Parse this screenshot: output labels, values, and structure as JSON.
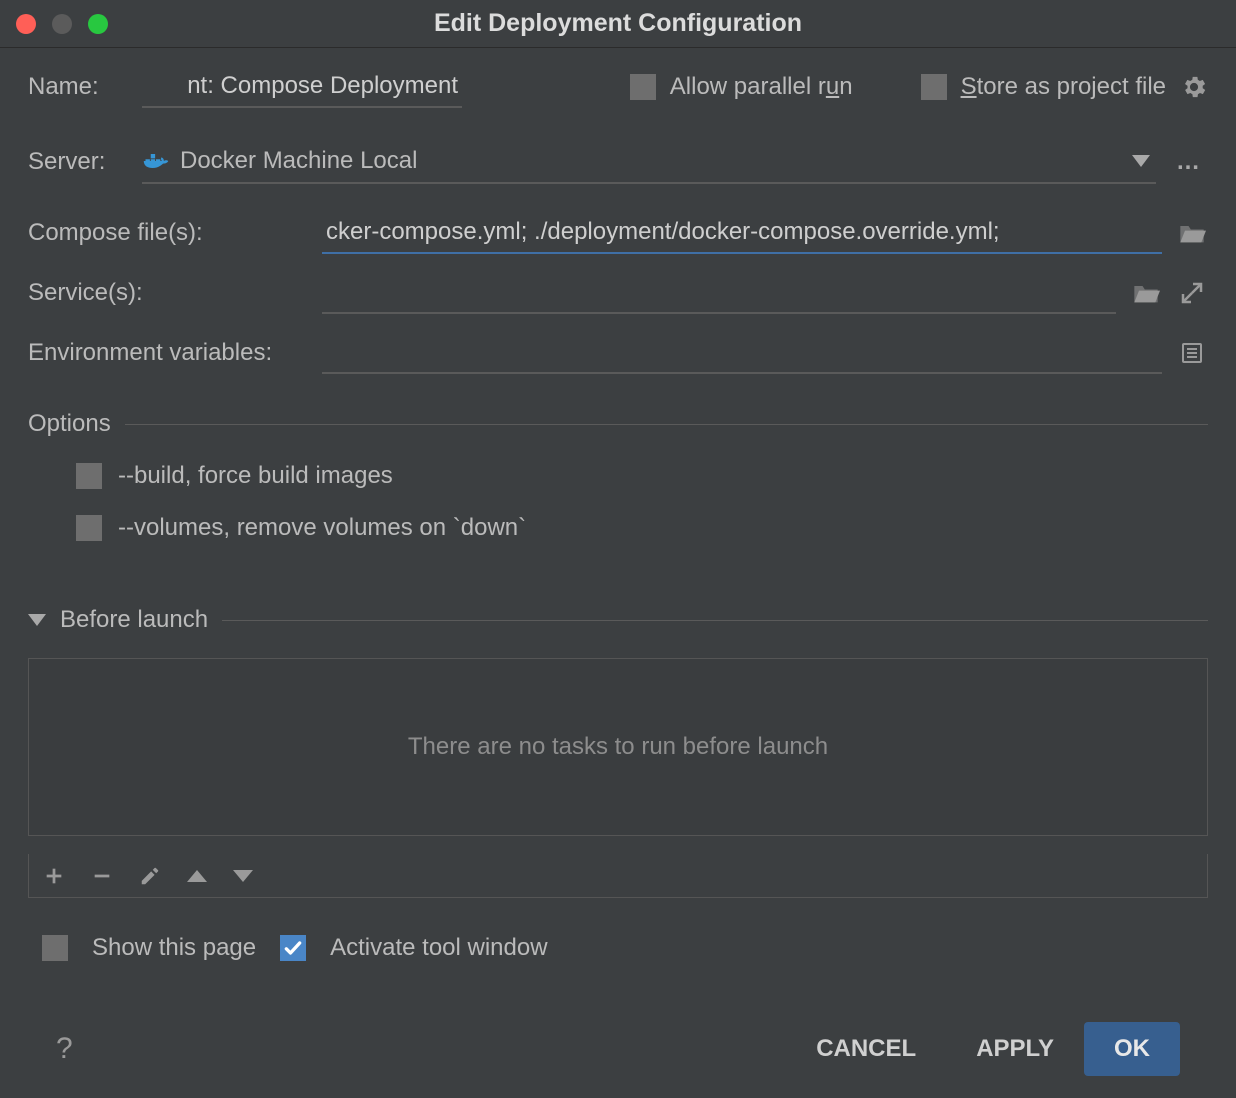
{
  "title": "Edit Deployment Configuration",
  "labels": {
    "name": "Name:",
    "allow_parallel_prefix": "Allow parallel r",
    "allow_parallel_mn": "u",
    "allow_parallel_suffix": "n",
    "store_mn": "S",
    "store_suffix": "tore as project file",
    "server": "Server:",
    "compose": "Compose file(s):",
    "services": "Service(s):",
    "env": "Environment variables:",
    "options": "Options",
    "build": "--build, force build images",
    "volumes": "--volumes, remove volumes on `down`",
    "before_launch": "Before launch",
    "no_tasks": "There are no tasks to run before launch",
    "show_page": "Show this page",
    "activate_tool": "Activate tool window",
    "help": "?"
  },
  "values": {
    "name": "nt: Compose Deployment",
    "server": "Docker Machine Local",
    "compose": "cker-compose.yml; ./deployment/docker-compose.override.yml;",
    "services": "",
    "env": ""
  },
  "checks": {
    "allow_parallel": false,
    "store_project": false,
    "build": false,
    "volumes": false,
    "show_page": false,
    "activate_tool": true
  },
  "buttons": {
    "cancel": "CANCEL",
    "apply": "APPLY",
    "ok": "OK"
  }
}
